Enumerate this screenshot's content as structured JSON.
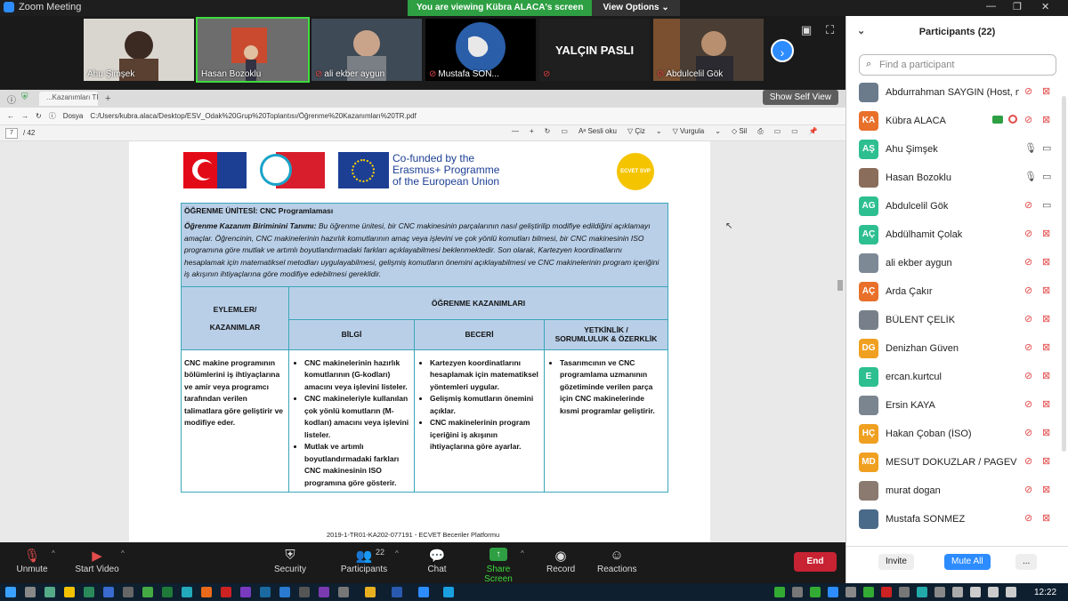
{
  "window": {
    "title": "Zoom Meeting",
    "banner_text": "You are viewing Kübra ALACA's screen",
    "view_options": "View Options ⌄",
    "min": "—",
    "max": "❐",
    "close": "✕"
  },
  "video_strip": {
    "tiles": [
      {
        "name": "Ahu Şimşek",
        "muted": false,
        "type": "photo"
      },
      {
        "name": "Hasan Bozoklu",
        "muted": false,
        "type": "photo",
        "active": true
      },
      {
        "name": "ali ekber aygun",
        "muted": true,
        "type": "photo"
      },
      {
        "name": "Mustafa SON...",
        "muted": true,
        "type": "photo"
      },
      {
        "name": "",
        "muted": true,
        "type": "text",
        "bigname": "YALÇIN PASLI"
      },
      {
        "name": "Abdulcelil Gök",
        "muted": true,
        "type": "photo"
      }
    ],
    "next_icon": "›"
  },
  "browser": {
    "tab_label": "...Kazanımları TR.pdf",
    "show_self_view": "Show Self View",
    "address_prefix": "Dosya",
    "address": "C:/Users/kubra.alaca/Desktop/ESV_Odak%20Grup%20Toplantısı/Öğrenme%20Kazanımları%20TR.pdf",
    "page_current": "7",
    "page_total": "/ 42",
    "tools": [
      "—",
      "+",
      "↻",
      "▭",
      "Aᵃ Sesli oku",
      "▽ Çiz",
      "⌄",
      "▽ Vurgula",
      "⌄",
      "◇ Sil",
      "⎙",
      "▭",
      "▭",
      "📌"
    ]
  },
  "pdf": {
    "cofunded": [
      "Co-funded by the",
      "Erasmus+ Programme",
      "of the European Union"
    ],
    "ecvet": "ECVET SVP",
    "unit_title": "ÖĞRENME ÜNİTESİ: CNC Programlaması",
    "desc_label": "Öğrenme Kazanım Biriminini Tanımı:",
    "desc_text": " Bu öğrenme ünitesi, bir CNC makinesinin parçalarının nasıl geliştirilip modifiye edildiğini açıklamayı amaçlar. Öğrencinin, CNC makinelerinin hazırlık komutlarının amaç veya işlevini ve çok yönlü komutları bilmesi, bir CNC makinesinin ISO programına göre mutlak ve artımlı boyutlandırmadaki farkları açıklayabilmesi beklenmektedir. Son olarak, Kartezyen koordinatlarını hesaplamak için matematiksel metodları uygulayabilmesi, gelişmiş komutların önemini açıklayabilmesi ve CNC makinelerinin program içeriğini iş akışının ihtiyaçlarına göre modifiye edebilmesi gereklidir.",
    "h_actions_1": "EYLEMLER/",
    "h_actions_2": "KAZANIMLAR",
    "h_outcomes": "ÖĞRENME KAZANIMLARI",
    "h_knowledge": "BİLGİ",
    "h_skills": "BECERİ",
    "h_competence_1": "YETKİNLİK /",
    "h_competence_2": "SORUMLULUK & ÖZERKLİK",
    "actions_text": "CNC makine programının bölümlerini iş ihtiyaçlarına ve amir veya programcı tarafından verilen talimatlara göre geliştirir ve modifiye eder.",
    "knowledge_items": [
      "CNC makinelerinin hazırlık komutlarının (G-kodları) amacını veya işlevini listeler.",
      "CNC makineleriyle kullanılan çok yönlü komutların (M-kodları) amacını veya işlevini listeler.",
      "Mutlak ve artımlı boyutlandırmadaki farkları CNC makinesinin ISO programına göre gösterir."
    ],
    "skills_items": [
      "Kartezyen koordinatlarını hesaplamak için matematiksel yöntemleri uygular.",
      "Gelişmiş komutların önemini açıklar.",
      "CNC makinelerinin program içeriğini iş akışının ihtiyaçlarına göre ayarlar."
    ],
    "competence_items": [
      "Tasarımcının ve CNC programlama uzmanının gözetiminde verilen parça için CNC makinelerinde kısmi programlar geliştirir."
    ],
    "footer": "2019-1-TR01-KA202-077191 - ECVET Beceriler Platformu"
  },
  "toolbar": {
    "unmute": "Unmute",
    "start_video": "Start Video",
    "security": "Security",
    "participants": "Participants",
    "participants_count": "22",
    "chat": "Chat",
    "share_screen": "Share Screen",
    "record": "Record",
    "reactions": "Reactions",
    "end": "End"
  },
  "panel": {
    "title": "Participants (22)",
    "search_placeholder": "Find a participant",
    "participants": [
      {
        "name": "Abdurrahman SAYGIN (Host, me)",
        "initials": "",
        "color": "#6b7b8c",
        "mic": false,
        "cam": false
      },
      {
        "name": "Kübra ALACA",
        "initials": "KA",
        "color": "#e8702a",
        "mic": false,
        "cam": false,
        "sharing": true
      },
      {
        "name": "Ahu Şimşek",
        "initials": "AŞ",
        "color": "#2ebf91",
        "mic": true,
        "cam": true
      },
      {
        "name": "Hasan Bozoklu",
        "initials": "",
        "color": "#8a6d5a",
        "mic": true,
        "cam": true
      },
      {
        "name": "Abdulcelil Gök",
        "initials": "AG",
        "color": "#2ebf91",
        "mic": false,
        "cam": true
      },
      {
        "name": "Abdülhamit Çolak",
        "initials": "AÇ",
        "color": "#2ebf91",
        "mic": false,
        "cam": false
      },
      {
        "name": "ali ekber aygun",
        "initials": "",
        "color": "#7d8a96",
        "mic": false,
        "cam": false
      },
      {
        "name": "Arda Çakır",
        "initials": "AÇ",
        "color": "#e8702a",
        "mic": false,
        "cam": false
      },
      {
        "name": "BÜLENT ÇELİK",
        "initials": "",
        "color": "#77808a",
        "mic": false,
        "cam": false
      },
      {
        "name": "Denizhan Güven",
        "initials": "DG",
        "color": "#f0a020",
        "mic": false,
        "cam": false
      },
      {
        "name": "ercan.kurtcul",
        "initials": "E",
        "color": "#2ebf91",
        "mic": false,
        "cam": false
      },
      {
        "name": "Ersin KAYA",
        "initials": "",
        "color": "#7a8590",
        "mic": false,
        "cam": false
      },
      {
        "name": "Hakan Çoban (İSO)",
        "initials": "HÇ",
        "color": "#f0a020",
        "mic": false,
        "cam": false
      },
      {
        "name": "MESUT DOKUZLAR / PAGEV Plast...",
        "initials": "MD",
        "color": "#f0a020",
        "mic": false,
        "cam": false
      },
      {
        "name": "murat dogan",
        "initials": "",
        "color": "#8a7a70",
        "mic": false,
        "cam": false
      },
      {
        "name": "Mustafa SONMEZ",
        "initials": "",
        "color": "#4a6a8a",
        "mic": false,
        "cam": false
      }
    ],
    "invite": "Invite",
    "mute_all": "Mute All",
    "more": "..."
  },
  "taskbar": {
    "time": "12:22"
  }
}
